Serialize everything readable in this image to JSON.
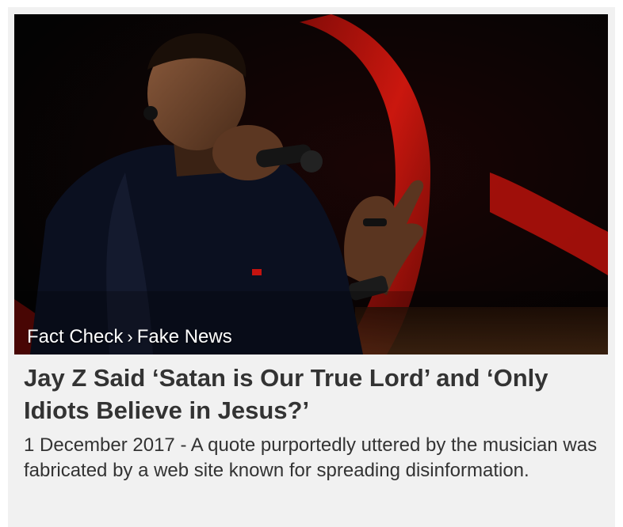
{
  "breadcrumb": {
    "section": "Fact Check",
    "separator": "›",
    "category": "Fake News"
  },
  "article": {
    "image_alt": "Jay Z performing on stage with a microphone",
    "headline": "Jay Z Said ‘Satan is Our True Lord’ and ‘Only Idiots Believe in Jesus?’",
    "date": "1 December 2017",
    "date_separator": "-",
    "excerpt": "A quote purportedly uttered by the musician was fabricated by a web site known for spreading disinformation."
  },
  "colors": {
    "card_background": "#f1f1f1",
    "text": "#333333",
    "stage_red": "#c4130f"
  }
}
